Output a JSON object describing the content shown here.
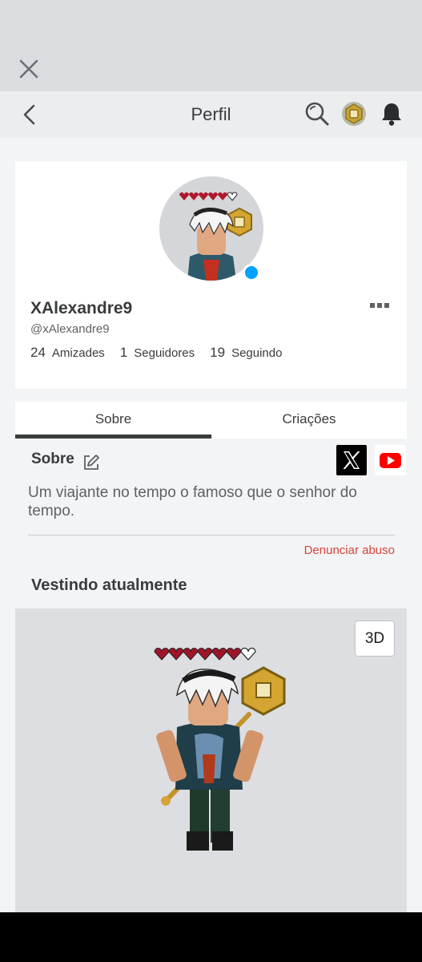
{
  "nav": {
    "title": "Perfil",
    "icons": [
      "close-icon",
      "back-icon",
      "search-icon",
      "robux-icon",
      "bell-icon"
    ]
  },
  "profile": {
    "display_name": "XAlexandre9",
    "username": "@xAlexandre9",
    "status": "online",
    "stats": [
      {
        "value": "24",
        "label": "Amizades"
      },
      {
        "value": "1",
        "label": "Seguidores"
      },
      {
        "value": "19",
        "label": "Seguindo"
      }
    ]
  },
  "tabs": [
    {
      "label": "Sobre",
      "selected": true
    },
    {
      "label": "Criações",
      "selected": false
    }
  ],
  "about": {
    "title": "Sobre",
    "bio": "Um viajante no tempo o famoso que o senhor do tempo.",
    "report_label": "Denunciar abuso",
    "social_icons": [
      "x-icon",
      "youtube-icon"
    ]
  },
  "wearing": {
    "title": "Vestindo atualmente",
    "view_3d_label": "3D"
  },
  "colors": {
    "accent_online": "#00a2ff",
    "report": "#d8433a",
    "youtube": "#ff0000"
  }
}
